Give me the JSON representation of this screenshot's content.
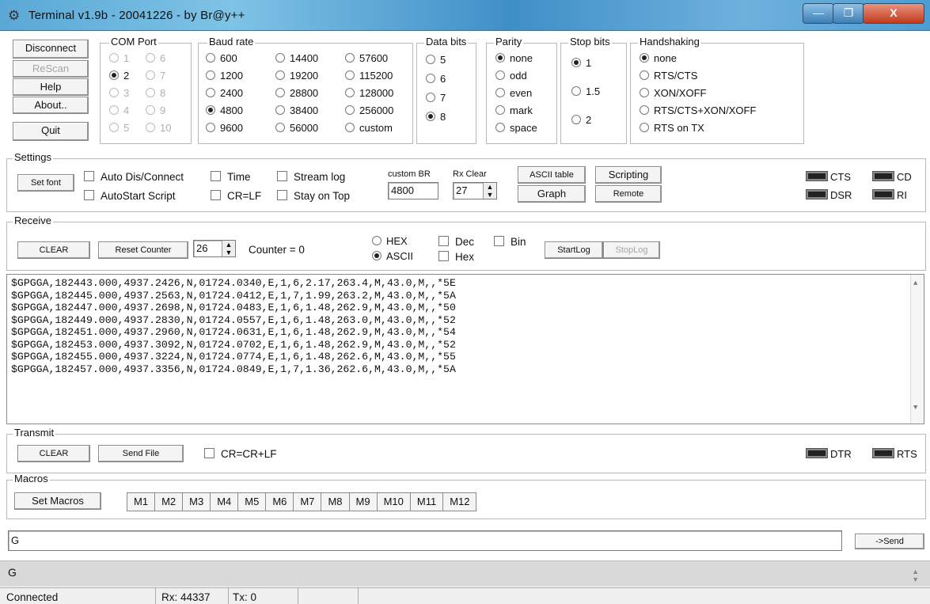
{
  "window": {
    "title": "Terminal v1.9b - 20041226 - by Br@y++",
    "controls": {
      "minimize": "—",
      "maximize": "❐",
      "close": "X"
    }
  },
  "left_buttons": [
    {
      "label": "Disconnect",
      "enabled": true
    },
    {
      "label": "ReScan",
      "enabled": false
    },
    {
      "label": "Help",
      "enabled": true
    },
    {
      "label": "About..",
      "enabled": true
    },
    {
      "label": "Quit",
      "enabled": true
    }
  ],
  "com_port": {
    "label": "COM Port",
    "options": [
      {
        "label": "1",
        "selected": false,
        "dim": true
      },
      {
        "label": "6",
        "selected": false,
        "dim": true
      },
      {
        "label": "2",
        "selected": true,
        "dim": false
      },
      {
        "label": "7",
        "selected": false,
        "dim": true
      },
      {
        "label": "3",
        "selected": false,
        "dim": true
      },
      {
        "label": "8",
        "selected": false,
        "dim": true
      },
      {
        "label": "4",
        "selected": false,
        "dim": true
      },
      {
        "label": "9",
        "selected": false,
        "dim": true
      },
      {
        "label": "5",
        "selected": false,
        "dim": true
      },
      {
        "label": "10",
        "selected": false,
        "dim": true
      }
    ]
  },
  "baud_rate": {
    "label": "Baud rate",
    "options": [
      {
        "label": "600",
        "selected": false
      },
      {
        "label": "14400",
        "selected": false
      },
      {
        "label": "57600",
        "selected": false
      },
      {
        "label": "1200",
        "selected": false
      },
      {
        "label": "19200",
        "selected": false
      },
      {
        "label": "115200",
        "selected": false
      },
      {
        "label": "2400",
        "selected": false
      },
      {
        "label": "28800",
        "selected": false
      },
      {
        "label": "128000",
        "selected": false
      },
      {
        "label": "4800",
        "selected": true
      },
      {
        "label": "38400",
        "selected": false
      },
      {
        "label": "256000",
        "selected": false
      },
      {
        "label": "9600",
        "selected": false
      },
      {
        "label": "56000",
        "selected": false
      },
      {
        "label": "custom",
        "selected": false
      }
    ]
  },
  "data_bits": {
    "label": "Data bits",
    "options": [
      {
        "label": "5",
        "selected": false
      },
      {
        "label": "6",
        "selected": false
      },
      {
        "label": "7",
        "selected": false
      },
      {
        "label": "8",
        "selected": true
      }
    ]
  },
  "parity": {
    "label": "Parity",
    "options": [
      {
        "label": "none",
        "selected": true
      },
      {
        "label": "odd",
        "selected": false
      },
      {
        "label": "even",
        "selected": false
      },
      {
        "label": "mark",
        "selected": false
      },
      {
        "label": "space",
        "selected": false
      }
    ]
  },
  "stop_bits": {
    "label": "Stop bits",
    "options": [
      {
        "label": "1",
        "selected": true
      },
      {
        "label": "1.5",
        "selected": false
      },
      {
        "label": "2",
        "selected": false
      }
    ]
  },
  "handshaking": {
    "label": "Handshaking",
    "options": [
      {
        "label": "none",
        "selected": true
      },
      {
        "label": "RTS/CTS",
        "selected": false
      },
      {
        "label": "XON/XOFF",
        "selected": false
      },
      {
        "label": "RTS/CTS+XON/XOFF",
        "selected": false
      },
      {
        "label": "RTS on TX",
        "selected": false
      }
    ]
  },
  "settings": {
    "label": "Settings",
    "set_font": "Set font",
    "checks": [
      {
        "label": "Auto Dis/Connect",
        "checked": false
      },
      {
        "label": "AutoStart Script",
        "checked": false
      },
      {
        "label": "Time",
        "checked": false
      },
      {
        "label": "CR=LF",
        "checked": false
      },
      {
        "label": "Stream log",
        "checked": false
      },
      {
        "label": "Stay on Top",
        "checked": false
      }
    ],
    "custom_br_label": "custom BR",
    "custom_br_value": "4800",
    "rx_clear_label": "Rx Clear",
    "rx_clear_value": "27",
    "ascii_table": "ASCII table",
    "scripting": "Scripting",
    "graph": "Graph",
    "remote": "Remote",
    "indicators": [
      "CTS",
      "CD",
      "DSR",
      "RI"
    ]
  },
  "receive": {
    "label": "Receive",
    "clear": "CLEAR",
    "reset_counter": "Reset Counter",
    "counter_spin": "26",
    "counter_text": "Counter = 0",
    "hex": "HEX",
    "ascii": "ASCII",
    "dec": "Dec",
    "bin": "Bin",
    "hex_check": "Hex",
    "start_log": "StartLog",
    "stop_log": "StopLog",
    "lines": [
      "$GPGGA,182443.000,4937.2426,N,01724.0340,E,1,6,2.17,263.4,M,43.0,M,,*5E",
      "$GPGGA,182445.000,4937.2563,N,01724.0412,E,1,7,1.99,263.2,M,43.0,M,,*5A",
      "$GPGGA,182447.000,4937.2698,N,01724.0483,E,1,6,1.48,262.9,M,43.0,M,,*50",
      "$GPGGA,182449.000,4937.2830,N,01724.0557,E,1,6,1.48,263.0,M,43.0,M,,*52",
      "$GPGGA,182451.000,4937.2960,N,01724.0631,E,1,6,1.48,262.9,M,43.0,M,,*54",
      "$GPGGA,182453.000,4937.3092,N,01724.0702,E,1,6,1.48,262.9,M,43.0,M,,*52",
      "$GPGGA,182455.000,4937.3224,N,01724.0774,E,1,6,1.48,262.6,M,43.0,M,,*55",
      "$GPGGA,182457.000,4937.3356,N,01724.0849,E,1,7,1.36,262.6,M,43.0,M,,*5A"
    ]
  },
  "transmit": {
    "label": "Transmit",
    "clear": "CLEAR",
    "send_file": "Send File",
    "cr_check": "CR=CR+LF",
    "indicators": [
      "DTR",
      "RTS"
    ]
  },
  "macros": {
    "label": "Macros",
    "set_macros": "Set Macros",
    "buttons": [
      "M1",
      "M2",
      "M3",
      "M4",
      "M5",
      "M6",
      "M7",
      "M8",
      "M9",
      "M10",
      "M11",
      "M12"
    ]
  },
  "send": {
    "input_value": "G",
    "button": "->Send"
  },
  "echo_line": "G",
  "status": {
    "state": "Connected",
    "rx": "Rx: 44337",
    "tx": "Tx: 0"
  }
}
